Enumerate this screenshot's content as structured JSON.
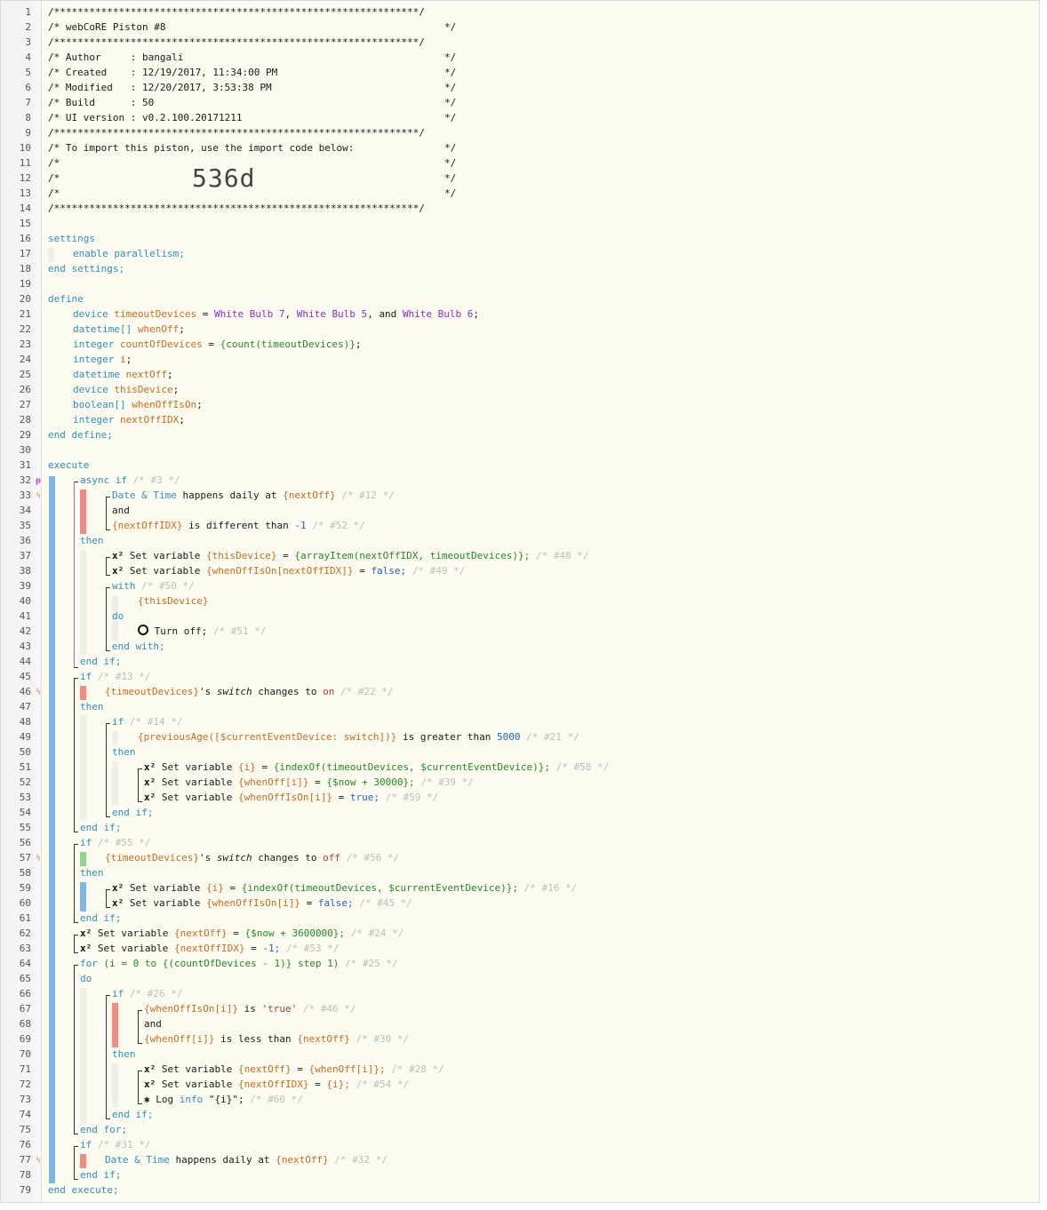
{
  "gutter_lines": [
    "1",
    "2",
    "3",
    "4",
    "5",
    "6",
    "7",
    "8",
    "9",
    "10",
    "11",
    "12",
    "13",
    "14",
    "15",
    "16",
    "17",
    "18",
    "19",
    "20",
    "21",
    "22",
    "23",
    "24",
    "25",
    "26",
    "27",
    "28",
    "29",
    "30",
    "31",
    "32",
    "33",
    "34",
    "35",
    "36",
    "37",
    "38",
    "39",
    "40",
    "41",
    "42",
    "43",
    "44",
    "45",
    "46",
    "47",
    "48",
    "49",
    "50",
    "51",
    "52",
    "53",
    "54",
    "55",
    "56",
    "57",
    "58",
    "59",
    "60",
    "61",
    "62",
    "63",
    "64",
    "65",
    "66",
    "67",
    "68",
    "69",
    "70",
    "71",
    "72",
    "73",
    "74",
    "75",
    "76",
    "77",
    "78",
    "79"
  ],
  "header": {
    "l1": "/**************************************************************/",
    "l2a": "/* webCoRE Piston #8",
    "l2b": "*/",
    "l3": "/**************************************************************/",
    "l4a": "/* Author     : bangali",
    "l4b": "*/",
    "l5a": "/* Created    : 12/19/2017, 11:34:00 PM",
    "l5b": "*/",
    "l6a": "/* Modified   : 12/20/2017, 3:53:38 PM",
    "l6b": "*/",
    "l7a": "/* Build      : 50",
    "l7b": "*/",
    "l8a": "/* UI version : v0.2.100.20171211",
    "l8b": "*/",
    "l9": "/**************************************************************/",
    "l10a": "/* To import this piston, use the import code below:",
    "l10b": "*/",
    "l11a": "/*",
    "l11b": "*/",
    "l12a": "/*",
    "l12b": "*/",
    "l13a": "/*",
    "l13b": "*/",
    "l14": "/**************************************************************/",
    "import_code": "536d"
  },
  "code": {
    "settings": "settings",
    "enable_par": "enable parallelism;",
    "end_settings": "end settings;",
    "define": "define",
    "d_device": "device",
    "d_timeoutDevices": "timeoutDevices",
    "eq": "=",
    "bulb7": "White Bulb 7",
    "bulb5": "White Bulb 5",
    "and_word": "and",
    "bulb6": "White Bulb 6",
    "d_datetime_arr": "datetime[]",
    "d_whenOff": "whenOff",
    "d_integer": "integer",
    "d_countOfDevices": "countOfDevices",
    "d_count_expr": "{count(timeoutDevices)}",
    "d_i": "i",
    "d_datetime": "datetime",
    "d_nextOff": "nextOff",
    "d_thisDevice": "thisDevice",
    "d_boolean_arr": "boolean[]",
    "d_whenOffIsOn": "whenOffIsOn",
    "d_nextOffIDX": "nextOffIDX",
    "end_define": "end define;",
    "execute": "execute",
    "async_if": "async if",
    "c3": "/* #3 */",
    "dt": "Date & Time",
    "happens_daily_at": "happens daily at",
    "v_nextOff": "{nextOff}",
    "c12": "/* #12 */",
    "and": "and",
    "v_nextOffIDX": "{nextOffIDX}",
    "is_diff": "is different than",
    "neg1": "-1",
    "c52": "/* #52 */",
    "then": "then",
    "x2": "x²",
    "set_variable": "Set variable",
    "v_thisDevice": "{thisDevice}",
    "arrayItem": "{arrayItem(nextOffIDX, timeoutDevices)};",
    "c48": "/* #48 */",
    "v_whenOffIsOnIdx": "{whenOffIsOn[nextOffIDX]}",
    "false_semi": "false;",
    "c49": "/* #49 */",
    "with": "with",
    "c50": "/* #50 */",
    "do": "do",
    "turn_off": "Turn off;",
    "c51": "/* #51 */",
    "end_with": "end with;",
    "end_if": "end if;",
    "if": "if",
    "c13": "/* #13 */",
    "v_timeoutDevices": "{timeoutDevices}",
    "s_apos": "'s",
    "switch": "switch",
    "changes_to": "changes to",
    "on": "on",
    "c22": "/* #22 */",
    "c14": "/* #14 */",
    "prevAge": "{previousAge([$currentEventDevice: switch])}",
    "is_greater": "is greater than",
    "n5000": "5000",
    "c21": "/* #21 */",
    "v_i": "{i}",
    "indexOf": "{indexOf(timeoutDevices, $currentEventDevice)};",
    "c58": "/* #58 */",
    "v_whenOffI": "{whenOff[i]}",
    "now30000": "{$now + 30000};",
    "c39": "/* #39 */",
    "v_whenOffIsOnI": "{whenOffIsOn[i]}",
    "true_semi": "true;",
    "c59": "/* #59 */",
    "c55": "/* #55 */",
    "off": "off",
    "c56": "/* #56 */",
    "c16": "/* #16 */",
    "c45": "/* #45 */",
    "now3600000": "{$now + 3600000};",
    "c24": "/* #24 */",
    "neg1_semi": "-1;",
    "c53": "/* #53 */",
    "for_kw": "for",
    "for_open": "(i = 0 to {(countOfDevices - 1)} step 1)",
    "c25": "/* #25 */",
    "c26": "/* #26 */",
    "is": "is",
    "true_str": "'true'",
    "c46": "/* #46 */",
    "is_less": "is less than",
    "c30": "/* #30 */",
    "whenOffI_semi": "{whenOff[i]};",
    "c28": "/* #28 */",
    "i_semi": "{i};",
    "c54": "/* #54 */",
    "log": "Log",
    "info": "info",
    "log_str": "\"{i}\";",
    "c60": "/* #60 */",
    "end_for": "end for;",
    "c31": "/* #31 */",
    "c32": "/* #32 */",
    "end_execute": "end execute;"
  },
  "colors": {
    "keyword": "#2b8fbf",
    "variable": "#d2691e",
    "device": "#8a2be2",
    "expression": "#228b22",
    "number": "#1f5fcf",
    "bar_blue": "#7fb6ea",
    "bar_red": "#f08c84",
    "bar_green": "#8fd48a"
  }
}
